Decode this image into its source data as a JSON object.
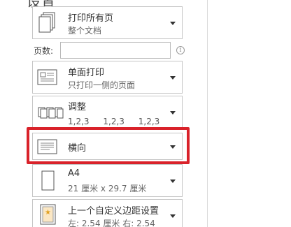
{
  "section": {
    "title": "设置"
  },
  "print_what": {
    "title": "打印所有页",
    "subtitle": "整个文档",
    "icon": "document-stack-icon"
  },
  "pages": {
    "label": "页数:",
    "value": "",
    "info_icon": "info-icon"
  },
  "sides": {
    "title": "单面打印",
    "subtitle": "只打印一侧的页面",
    "icon": "single-sided-icon"
  },
  "collate": {
    "title": "调整",
    "numbers": [
      "1,2,3",
      "1,2,3",
      "1,2,3"
    ],
    "icon": "collate-icon"
  },
  "orientation": {
    "title": "横向",
    "icon": "landscape-page-icon"
  },
  "paper_size": {
    "title": "A4",
    "subtitle": "21 厘米 x 29.7 厘米",
    "icon": "portrait-page-icon"
  },
  "margins": {
    "title": "上一个自定义边距设置",
    "subtitle": "左: 2.54 厘米    右: 2.54",
    "icon": "margins-icon"
  },
  "colors": {
    "highlight": "#d9222a",
    "border": "#c6c6c6"
  }
}
